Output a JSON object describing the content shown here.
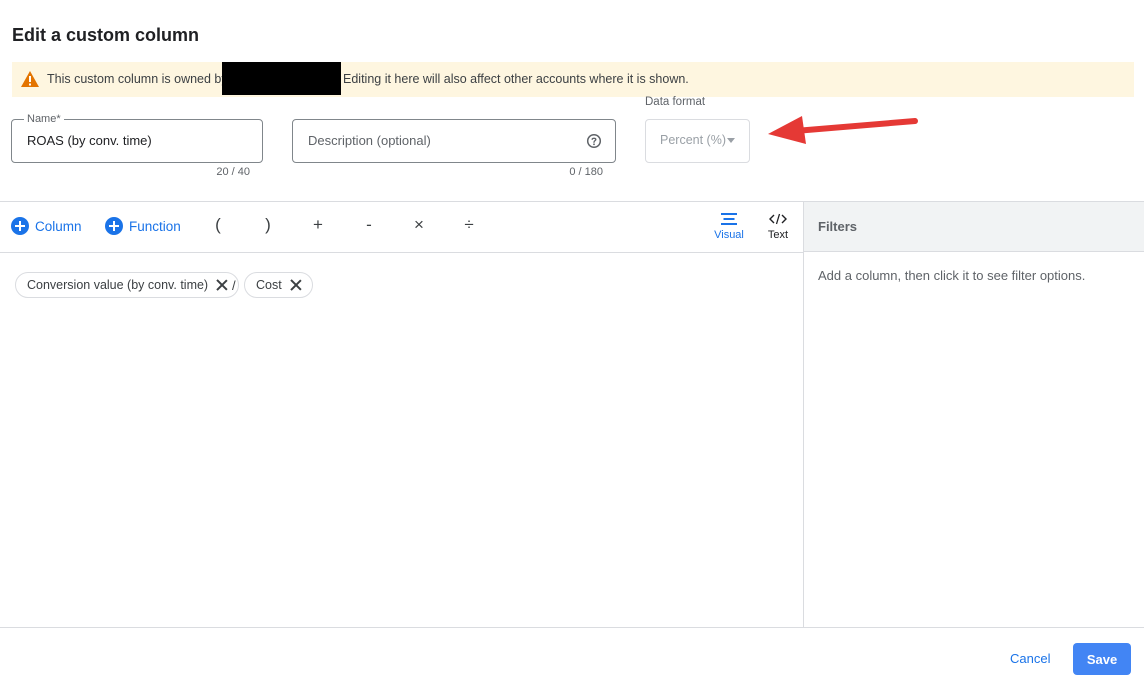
{
  "dialog": {
    "title": "Edit a custom column"
  },
  "warning": {
    "text_before": "This custom column is owned by",
    "text_after": "Editing it here will also affect other accounts where it is shown."
  },
  "name": {
    "label": "Name*",
    "value": "ROAS (by conv. time)",
    "counter": "20 / 40"
  },
  "description": {
    "placeholder": "Description (optional)",
    "counter": "0 / 180"
  },
  "data_format": {
    "label": "Data format",
    "value": "Percent (%)"
  },
  "toolbar": {
    "column_label": "Column",
    "function_label": "Function",
    "operators": [
      "(",
      ")",
      "+",
      "-",
      "×",
      "÷"
    ],
    "visual_label": "Visual",
    "text_label": "Text"
  },
  "formula": {
    "tokens": [
      "Conversion value (by conv. time)",
      "/",
      "Cost"
    ]
  },
  "filters": {
    "title": "Filters",
    "message": "Add a column, then click it to see filter options."
  },
  "footer": {
    "cancel_label": "Cancel",
    "save_label": "Save"
  },
  "colors": {
    "accent": "#1a73e8",
    "warning_bg": "#fef6e0",
    "annotation_arrow": "#e53935"
  }
}
